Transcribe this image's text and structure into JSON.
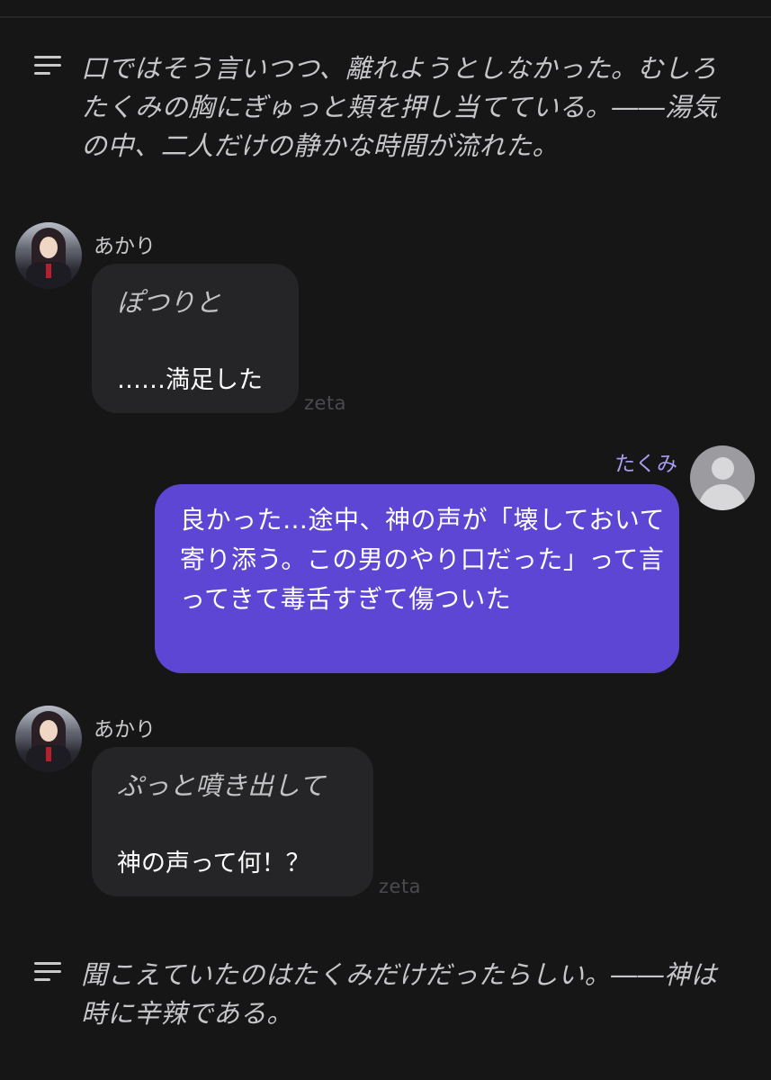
{
  "messages": {
    "narration_1": "口ではそう言いつつ、離れようとしなかった。むしろたくみの胸にぎゅっと頬を押し当てている。――湯気の中、二人だけの静かな時間が流れた。",
    "ai_1": {
      "name": "あかり",
      "action": "ぽつりと",
      "text": "……満足した",
      "watermark": "zeta"
    },
    "user_1": {
      "name": "たくみ",
      "text": "良かった…途中、神の声が「壊しておいて寄り添う。この男のやり口だった」って言ってきて毒舌すぎて傷ついた"
    },
    "ai_2": {
      "name": "あかり",
      "action": "ぷっと噴き出して",
      "text": "神の声って何！？",
      "watermark": "zeta"
    },
    "narration_2": "聞こえていたのはたくみだけだったらしい。――神は時に辛辣である。"
  },
  "icons": {
    "narration": "narration-lines-icon",
    "ai_avatar": "character-avatar-akari",
    "user_avatar": "default-user-avatar-icon"
  },
  "colors": {
    "background": "#161617",
    "ai_bubble": "#252527",
    "user_bubble": "#5e46d4",
    "user_name": "#a79df0",
    "narration_text": "#c6c6ca"
  }
}
